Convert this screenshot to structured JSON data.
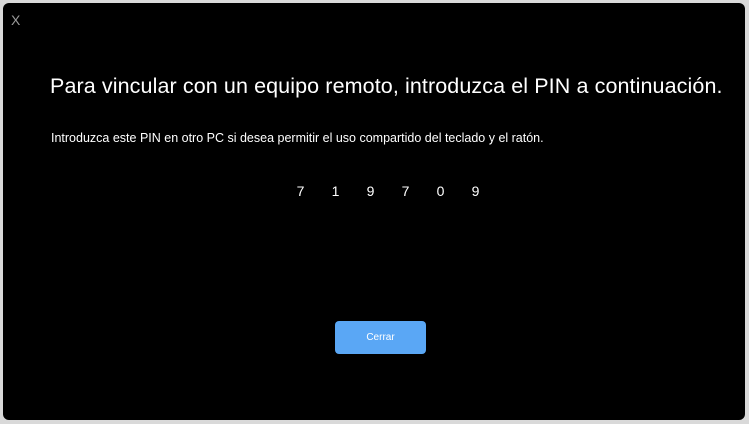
{
  "dialog": {
    "close_glyph": "X",
    "heading": "Para vincular con un equipo remoto, introduzca el PIN a continuación.",
    "instructions": "Introduzca este PIN en otro PC si desea permitir el uso compartido del teclado y el ratón.",
    "pin_digits": [
      "7",
      "1",
      "9",
      "7",
      "0",
      "9"
    ],
    "close_button_label": "Cerrar"
  },
  "colors": {
    "background": "#000000",
    "text": "#ffffff",
    "button": "#5aa7f5",
    "close_glyph": "#9a9a9a"
  }
}
